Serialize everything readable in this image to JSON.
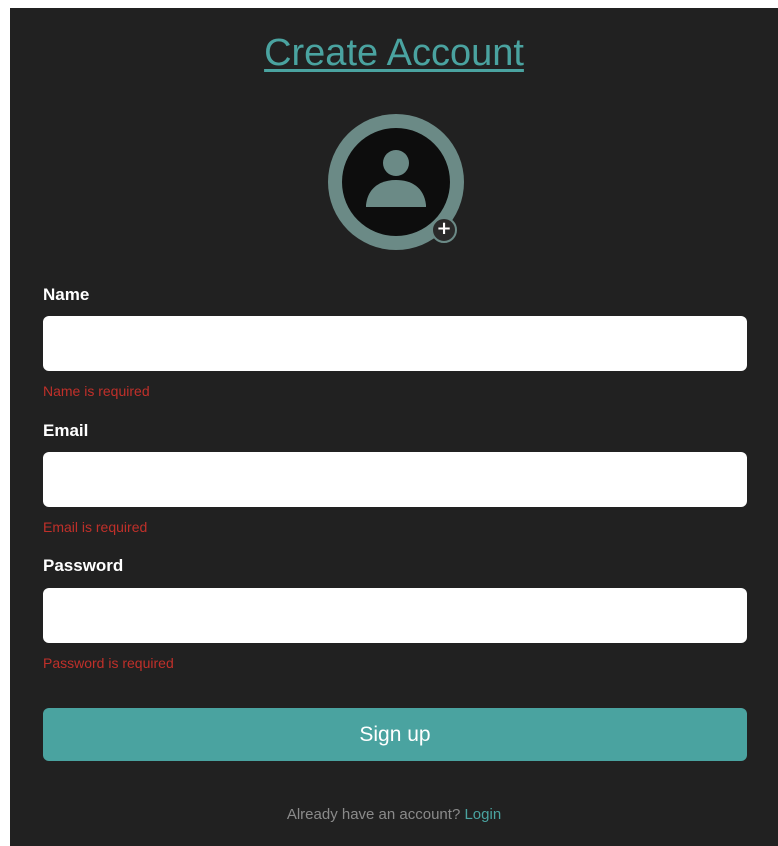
{
  "page": {
    "title": "Create Account"
  },
  "avatar": {
    "icon": "user-avatar-icon",
    "add_icon": "plus-icon",
    "add_glyph": "+"
  },
  "form": {
    "name": {
      "label": "Name",
      "value": "",
      "placeholder": "",
      "error": "Name is required"
    },
    "email": {
      "label": "Email",
      "value": "",
      "placeholder": "",
      "error": "Email is required"
    },
    "password": {
      "label": "Password",
      "value": "",
      "placeholder": "",
      "error": "Password is required"
    },
    "submit_label": "Sign up"
  },
  "footer": {
    "prompt": "Already have an account?",
    "login_label": "Login"
  },
  "colors": {
    "accent": "#4aa3a0",
    "background": "#212121",
    "error": "#c0302a",
    "avatar_ring": "#6b8a86"
  }
}
